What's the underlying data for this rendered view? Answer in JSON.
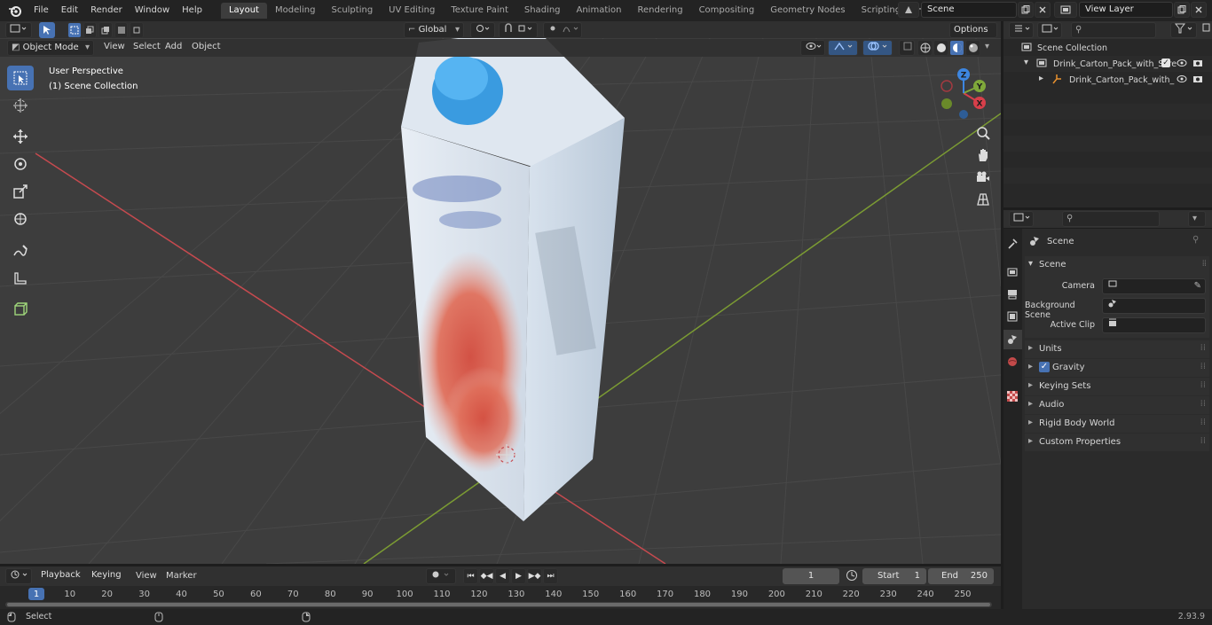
{
  "app": {
    "menus": [
      "File",
      "Edit",
      "Render",
      "Window",
      "Help"
    ],
    "workspaces": [
      "Layout",
      "Modeling",
      "Sculpting",
      "UV Editing",
      "Texture Paint",
      "Shading",
      "Animation",
      "Rendering",
      "Compositing",
      "Geometry Nodes",
      "Scripting"
    ],
    "active_workspace": "Layout",
    "scene_name": "Scene",
    "view_layer": "View Layer",
    "version": "2.93.9"
  },
  "viewport": {
    "mode": "Object Mode",
    "menus": [
      "View",
      "Select",
      "Add",
      "Object"
    ],
    "orientation": "Global",
    "options_label": "Options",
    "overlay_line1": "User Perspective",
    "overlay_line2": "(1) Scene Collection",
    "gizmo": {
      "x": "X",
      "y": "Y",
      "z": "Z"
    }
  },
  "outliner": {
    "root": "Scene Collection",
    "collection": "Drink_Carton_Pack_with_Scre",
    "object": "Drink_Carton_Pack_with_"
  },
  "properties": {
    "context": "Scene",
    "panel": "Scene",
    "fields": [
      {
        "label": "Camera",
        "value": ""
      },
      {
        "label": "Background Scene",
        "value": ""
      },
      {
        "label": "Active Clip",
        "value": ""
      }
    ],
    "subpanels": [
      "Units",
      "Gravity",
      "Keying Sets",
      "Audio",
      "Rigid Body World",
      "Custom Properties"
    ],
    "gravity_checked": true
  },
  "timeline": {
    "menus": [
      "Playback",
      "Keying",
      "View",
      "Marker"
    ],
    "current_frame": "1",
    "start_label": "Start",
    "start_value": "1",
    "end_label": "End",
    "end_value": "250",
    "ticks": [
      "1",
      "10",
      "20",
      "30",
      "40",
      "50",
      "60",
      "70",
      "80",
      "90",
      "100",
      "110",
      "120",
      "130",
      "140",
      "150",
      "160",
      "170",
      "180",
      "190",
      "200",
      "210",
      "220",
      "230",
      "240",
      "250"
    ]
  },
  "status": {
    "left": "Select"
  },
  "colors": {
    "accent": "#4772b3",
    "x_axis": "#d73f4a",
    "y_axis": "#7fa83a",
    "z_axis": "#3d86e0"
  }
}
